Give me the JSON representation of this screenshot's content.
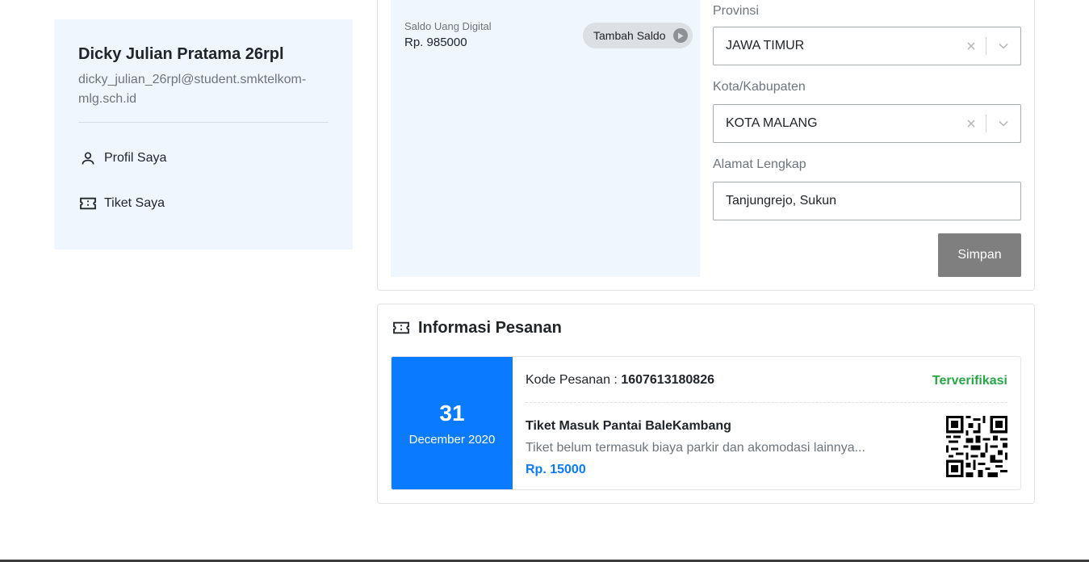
{
  "sidebar": {
    "name": "Dicky Julian Pratama 26rpl",
    "email": "dicky_julian_26rpl@student.smktelkom-mlg.sch.id",
    "items": [
      {
        "label": "Profil Saya",
        "icon": "user-icon"
      },
      {
        "label": "Tiket Saya",
        "icon": "ticket-icon"
      }
    ]
  },
  "wallet": {
    "label": "Saldo Uang Digital",
    "value": "Rp. 985000",
    "topup_label": "Tambah Saldo"
  },
  "form": {
    "province_label": "Provinsi",
    "province_value": "JAWA TIMUR",
    "city_label": "Kota/Kabupaten",
    "city_value": "KOTA MALANG",
    "address_label": "Alamat Lengkap",
    "address_value": "Tanjungrejo, Sukun",
    "save_label": "Simpan"
  },
  "order": {
    "heading": "Informasi Pesanan",
    "day": "31",
    "month_year": "December 2020",
    "code_label": "Kode Pesanan : ",
    "code_value": "1607613180826",
    "status": "Terverifikasi",
    "ticket_name": "Tiket Masuk Pantai BaleKambang",
    "ticket_desc": "Tiket belum termasuk biaya parkir dan akomodasi lainnya...",
    "price": "Rp. 15000"
  },
  "colors": {
    "primary": "#0a7bff",
    "success": "#28a745",
    "panel_bg": "#eff6fe",
    "save_button": "#7f7f7f"
  }
}
